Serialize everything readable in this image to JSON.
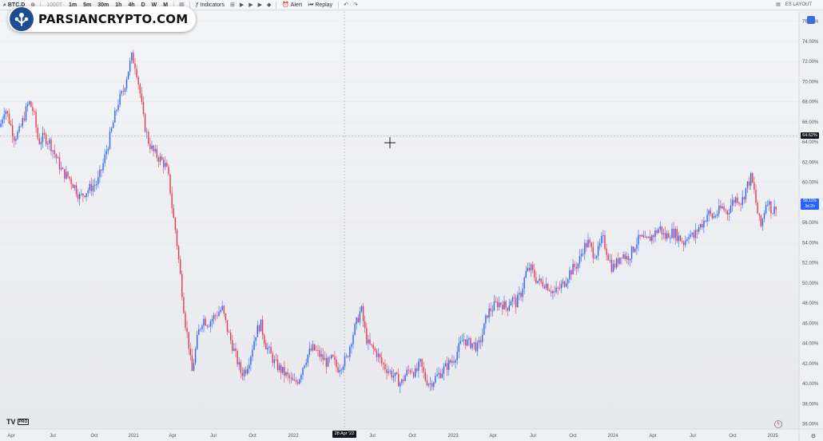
{
  "toolbar": {
    "symbol": "BTC.D",
    "intervals": [
      "1000T",
      "1m",
      "5m",
      "30m",
      "1h",
      "4h",
      "D",
      "W",
      "M"
    ],
    "indicators_label": "Indicators",
    "alert_label": "Alert",
    "replay_label": "Replay",
    "layout_label": "ES LAYOUT"
  },
  "logo": {
    "text": "PARSIANCRYPTO.COM"
  },
  "price_tag": "64.62%",
  "last_price_tag": {
    "value": "58.11%",
    "countdown": "3d 2h"
  },
  "date_tag": "28 Apr '22",
  "tv_logo": {
    "mark": "TV",
    "badge": "PRO"
  },
  "chart_data": {
    "type": "candlestick",
    "y_ticks": [
      "76.00%",
      "74.00%",
      "72.00%",
      "70.00%",
      "68.00%",
      "66.00%",
      "64.00%",
      "62.00%",
      "60.00%",
      "58.00%",
      "56.00%",
      "54.00%",
      "52.00%",
      "50.00%",
      "48.00%",
      "46.00%",
      "44.00%",
      "42.00%",
      "40.00%",
      "38.00%",
      "36.00%"
    ],
    "y_tick_values": [
      76,
      74,
      72,
      70,
      68,
      66,
      64,
      62,
      60,
      58,
      56,
      54,
      52,
      50,
      48,
      46,
      44,
      42,
      40,
      38,
      36
    ],
    "x_ticks": [
      "Apr",
      "Jul",
      "Oct",
      "2021",
      "Apr",
      "Jul",
      "Oct",
      "2022",
      "Jul",
      "Oct",
      "2023",
      "Apr",
      "Jul",
      "Oct",
      "2024",
      "Apr",
      "Jul",
      "Oct",
      "2025"
    ],
    "ylim": [
      35.5,
      77
    ],
    "crosshair_value": 64.62,
    "last_value": 58.11,
    "path": [
      [
        0,
        65.5
      ],
      [
        6,
        67.5
      ],
      [
        12,
        66
      ],
      [
        18,
        64.5
      ],
      [
        24,
        65
      ],
      [
        30,
        66.5
      ],
      [
        36,
        68
      ],
      [
        42,
        67
      ],
      [
        48,
        64
      ],
      [
        55,
        64.5
      ],
      [
        62,
        64
      ],
      [
        70,
        62.5
      ],
      [
        78,
        61
      ],
      [
        86,
        60.5
      ],
      [
        94,
        59.5
      ],
      [
        100,
        58.5
      ],
      [
        106,
        59
      ],
      [
        114,
        59.5
      ],
      [
        122,
        60
      ],
      [
        128,
        61.5
      ],
      [
        136,
        64
      ],
      [
        142,
        66
      ],
      [
        148,
        68
      ],
      [
        154,
        69
      ],
      [
        160,
        71
      ],
      [
        165,
        72.5
      ],
      [
        170,
        71.5
      ],
      [
        175,
        69
      ],
      [
        180,
        66
      ],
      [
        186,
        64
      ],
      [
        192,
        63
      ],
      [
        198,
        62.5
      ],
      [
        204,
        62
      ],
      [
        208,
        61.5
      ],
      [
        212,
        60
      ],
      [
        216,
        57
      ],
      [
        220,
        55
      ],
      [
        224,
        52
      ],
      [
        228,
        49
      ],
      [
        232,
        46
      ],
      [
        236,
        44
      ],
      [
        240,
        41
      ],
      [
        244,
        43
      ],
      [
        248,
        45
      ],
      [
        254,
        46.5
      ],
      [
        260,
        46
      ],
      [
        266,
        46.5
      ],
      [
        272,
        47
      ],
      [
        278,
        47.5
      ],
      [
        284,
        45.5
      ],
      [
        290,
        44
      ],
      [
        296,
        42.5
      ],
      [
        302,
        41
      ],
      [
        308,
        41.5
      ],
      [
        314,
        43
      ],
      [
        320,
        45
      ],
      [
        326,
        46
      ],
      [
        332,
        44
      ],
      [
        338,
        43
      ],
      [
        344,
        42
      ],
      [
        350,
        41.5
      ],
      [
        356,
        41
      ],
      [
        362,
        40.5
      ],
      [
        368,
        40
      ],
      [
        374,
        40.5
      ],
      [
        380,
        42
      ],
      [
        386,
        43
      ],
      [
        392,
        43.5
      ],
      [
        398,
        43
      ],
      [
        404,
        42.5
      ],
      [
        410,
        42
      ],
      [
        416,
        42.5
      ],
      [
        422,
        41.5
      ],
      [
        428,
        42
      ],
      [
        434,
        42.5
      ],
      [
        440,
        44.5
      ],
      [
        446,
        46
      ],
      [
        452,
        47.5
      ],
      [
        456,
        45.5
      ],
      [
        460,
        44
      ],
      [
        466,
        43.5
      ],
      [
        472,
        43
      ],
      [
        478,
        42
      ],
      [
        484,
        41.5
      ],
      [
        490,
        41
      ],
      [
        496,
        40.5
      ],
      [
        502,
        40
      ],
      [
        508,
        41
      ],
      [
        514,
        41.5
      ],
      [
        520,
        41
      ],
      [
        526,
        42
      ],
      [
        532,
        40.5
      ],
      [
        538,
        40
      ],
      [
        544,
        40.5
      ],
      [
        550,
        41
      ],
      [
        556,
        41.5
      ],
      [
        562,
        42
      ],
      [
        568,
        42.5
      ],
      [
        574,
        43.5
      ],
      [
        580,
        44.5
      ],
      [
        586,
        44
      ],
      [
        592,
        44
      ],
      [
        598,
        43.5
      ],
      [
        604,
        45
      ],
      [
        610,
        47
      ],
      [
        616,
        47.5
      ],
      [
        622,
        48
      ],
      [
        628,
        48
      ],
      [
        634,
        47.5
      ],
      [
        640,
        48.5
      ],
      [
        646,
        48
      ],
      [
        652,
        49
      ],
      [
        658,
        51
      ],
      [
        664,
        51.5
      ],
      [
        670,
        50.5
      ],
      [
        676,
        50
      ],
      [
        682,
        50
      ],
      [
        688,
        49.5
      ],
      [
        694,
        49
      ],
      [
        700,
        49.5
      ],
      [
        706,
        50
      ],
      [
        712,
        51
      ],
      [
        718,
        51.5
      ],
      [
        724,
        52
      ],
      [
        730,
        53.5
      ],
      [
        736,
        54
      ],
      [
        742,
        53
      ],
      [
        748,
        53
      ],
      [
        754,
        54.5
      ],
      [
        760,
        53
      ],
      [
        766,
        51.5
      ],
      [
        772,
        52
      ],
      [
        778,
        53
      ],
      [
        784,
        52.5
      ],
      [
        790,
        53
      ],
      [
        796,
        54
      ],
      [
        802,
        54.5
      ],
      [
        808,
        54
      ],
      [
        814,
        54.5
      ],
      [
        820,
        55
      ],
      [
        826,
        55.5
      ],
      [
        832,
        54.5
      ],
      [
        838,
        55
      ],
      [
        844,
        55
      ],
      [
        850,
        54.5
      ],
      [
        856,
        54
      ],
      [
        862,
        55
      ],
      [
        868,
        54.5
      ],
      [
        874,
        55.5
      ],
      [
        880,
        56
      ],
      [
        886,
        57
      ],
      [
        892,
        56.5
      ],
      [
        898,
        57
      ],
      [
        904,
        57.5
      ],
      [
        910,
        57
      ],
      [
        916,
        58
      ],
      [
        922,
        58.5
      ],
      [
        928,
        58
      ],
      [
        934,
        59.5
      ],
      [
        940,
        60.5
      ],
      [
        944,
        59
      ],
      [
        948,
        57
      ],
      [
        952,
        55.5
      ],
      [
        956,
        57
      ],
      [
        960,
        58.5
      ],
      [
        964,
        57.5
      ],
      [
        968,
        57
      ],
      [
        972,
        58
      ]
    ]
  }
}
